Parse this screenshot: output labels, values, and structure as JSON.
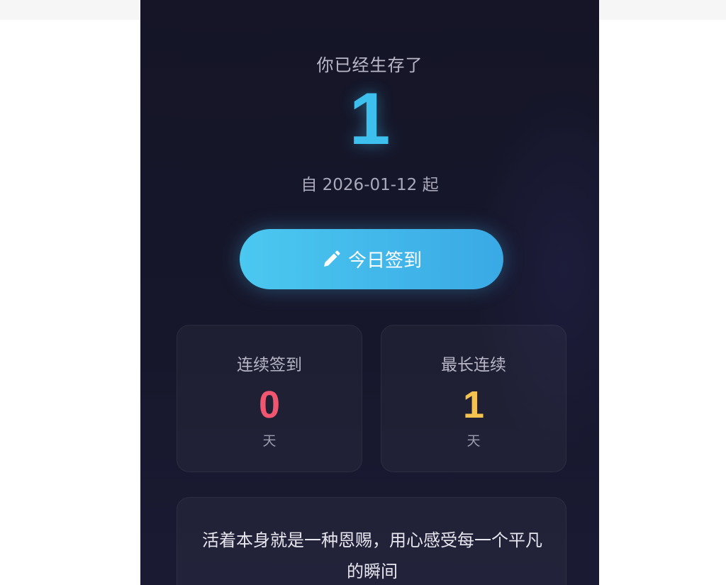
{
  "header": {
    "survived_label": "你已经生存了",
    "day_count": "1",
    "since_text": "自 2026-01-12 起"
  },
  "checkin": {
    "button_label": "今日签到",
    "icon": "pencil-icon"
  },
  "stats": {
    "streak": {
      "title": "连续签到",
      "value": "0",
      "unit": "天",
      "color": "#f0566f"
    },
    "longest": {
      "title": "最长连续",
      "value": "1",
      "unit": "天",
      "color": "#f3c24f"
    }
  },
  "quote": {
    "text": "活着本身就是一种恩赐，用心感受每一个平凡的瞬间"
  },
  "colors": {
    "background": "#151527",
    "accent": "#3ec0ef",
    "button_gradient_start": "#4bc8f0",
    "button_gradient_end": "#3aa9e5"
  }
}
